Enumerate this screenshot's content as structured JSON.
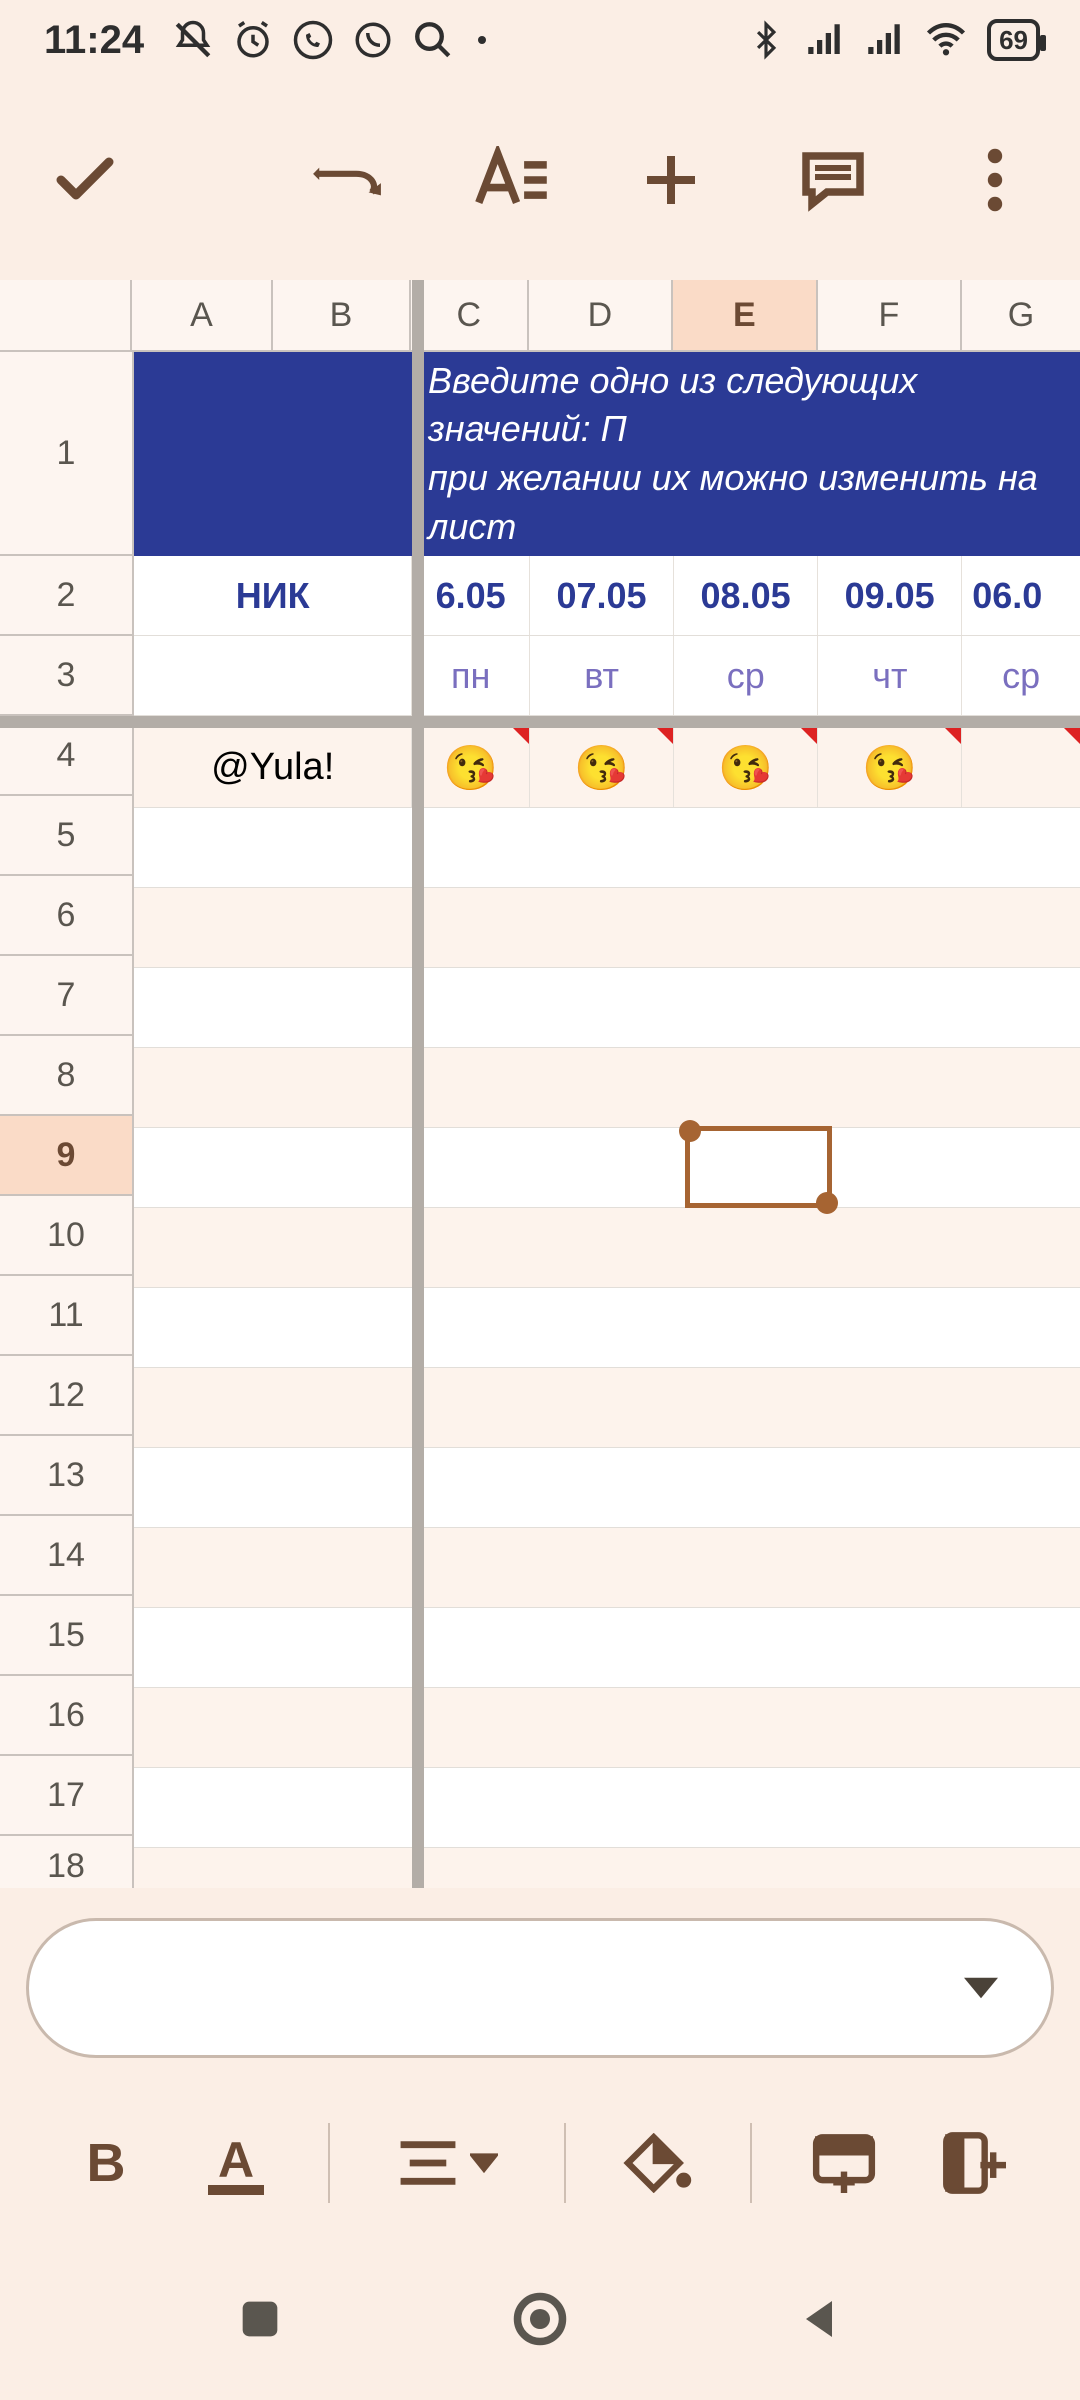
{
  "status_bar": {
    "time": "11:24",
    "battery": "69"
  },
  "toolbar": {
    "accept": "accept",
    "undo": "undo",
    "text_format": "text-format",
    "add": "add",
    "comment": "comment",
    "more": "more"
  },
  "sheet": {
    "col_headers": [
      "A",
      "B",
      "C",
      "D",
      "E",
      "F",
      "G"
    ],
    "row_headers": [
      "1",
      "2",
      "3",
      "4",
      "5",
      "6",
      "7",
      "8",
      "9",
      "10",
      "11",
      "12",
      "13",
      "14",
      "15",
      "16",
      "17",
      "18"
    ],
    "selected_col": "E",
    "selected_row": "9",
    "banner_line1": "Введите одно из следующих значений: П",
    "banner_line2": "при желании их можно изменить на лист",
    "row2": {
      "b": "НИК",
      "c": "6.05",
      "d": "07.05",
      "e": "08.05",
      "f": "09.05",
      "g": "06.0"
    },
    "row3": {
      "c": "пн",
      "d": "вт",
      "e": "ср",
      "f": "чт",
      "g": "ср"
    },
    "row4": {
      "b": "@Yula!",
      "emoji": "😘"
    }
  },
  "formula_bar": {
    "value": ""
  },
  "format_bar": {
    "bold": "B",
    "text_color": "A"
  }
}
